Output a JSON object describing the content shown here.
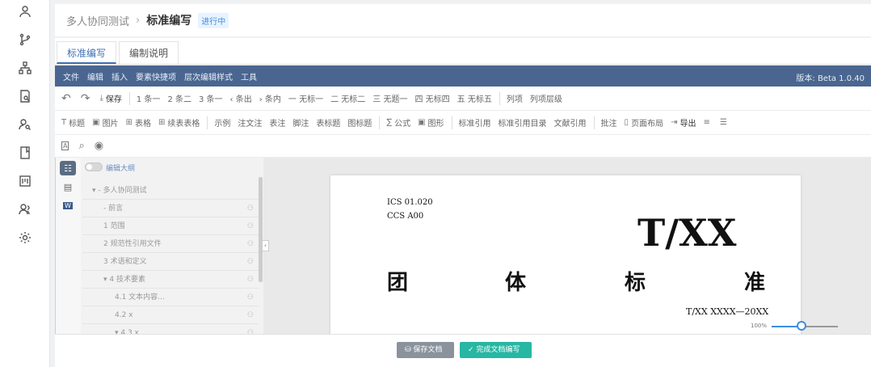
{
  "sidebar": {
    "icons": [
      "user-icon",
      "branch-icon",
      "org-icon",
      "document-search-icon",
      "users-search-icon",
      "book-icon",
      "board-icon",
      "user-group-icon",
      "settings-icon"
    ]
  },
  "breadcrumb": {
    "parent": "多人协同测试",
    "separator": "›",
    "title": "标准编写",
    "status": "进行中"
  },
  "tabs": [
    {
      "label": "标准编写",
      "active": true
    },
    {
      "label": "编制说明",
      "active": false
    }
  ],
  "menubar": {
    "items": [
      "文件",
      "编辑",
      "插入",
      "要素快捷项",
      "层次编辑样式",
      "工具"
    ],
    "version": "版本: Beta 1.0.40"
  },
  "toolbar1": {
    "undo": "↶",
    "redo": "↷",
    "save": "保存",
    "items": [
      "1 条一",
      "2 条二",
      "3 条一",
      "‹ 条出",
      "› 条内",
      "一 无标一",
      "二 无标二",
      "三 无题一",
      "四 无标四",
      "五 无标五",
      "列项",
      "列项层级"
    ]
  },
  "toolbar2": {
    "items": [
      "标题",
      "图片",
      "表格",
      "续表表格",
      "示例",
      "注文注",
      "表注",
      "脚注",
      "表标题",
      "图标题",
      "公式",
      "图形",
      "标准引用",
      "标准引用目录",
      "文献引用",
      "批注",
      "页面布局",
      "导出"
    ]
  },
  "toolbar3": {
    "icons": [
      "format-icon",
      "search-icon",
      "eye-icon"
    ]
  },
  "outline": {
    "toggle_label": "编辑大纲",
    "items": [
      {
        "label": "▾ - 多人协同测试",
        "indent": 0
      },
      {
        "label": "- 前言",
        "indent": 1
      },
      {
        "label": "1 范围",
        "indent": 1
      },
      {
        "label": "2 规范性引用文件",
        "indent": 1
      },
      {
        "label": "3 术语和定义",
        "indent": 1
      },
      {
        "label": "▾ 4 技术要素",
        "indent": 1
      },
      {
        "label": "4.1 文本内容...",
        "indent": 2
      },
      {
        "label": "4.2 x",
        "indent": 2
      },
      {
        "label": "▾ 4.3 x",
        "indent": 2
      }
    ]
  },
  "document": {
    "ics": "ICS  01.020",
    "ccs": "CCS  A00",
    "logo": "T/XX",
    "type_chars": [
      "团",
      "体",
      "标",
      "准"
    ],
    "standard_number": "T/XX  XXXX—20XX"
  },
  "zoom": {
    "label": "100%",
    "level": 0.45
  },
  "footer": {
    "save_label": "保存文档",
    "finish_label": "完成文档编写"
  }
}
